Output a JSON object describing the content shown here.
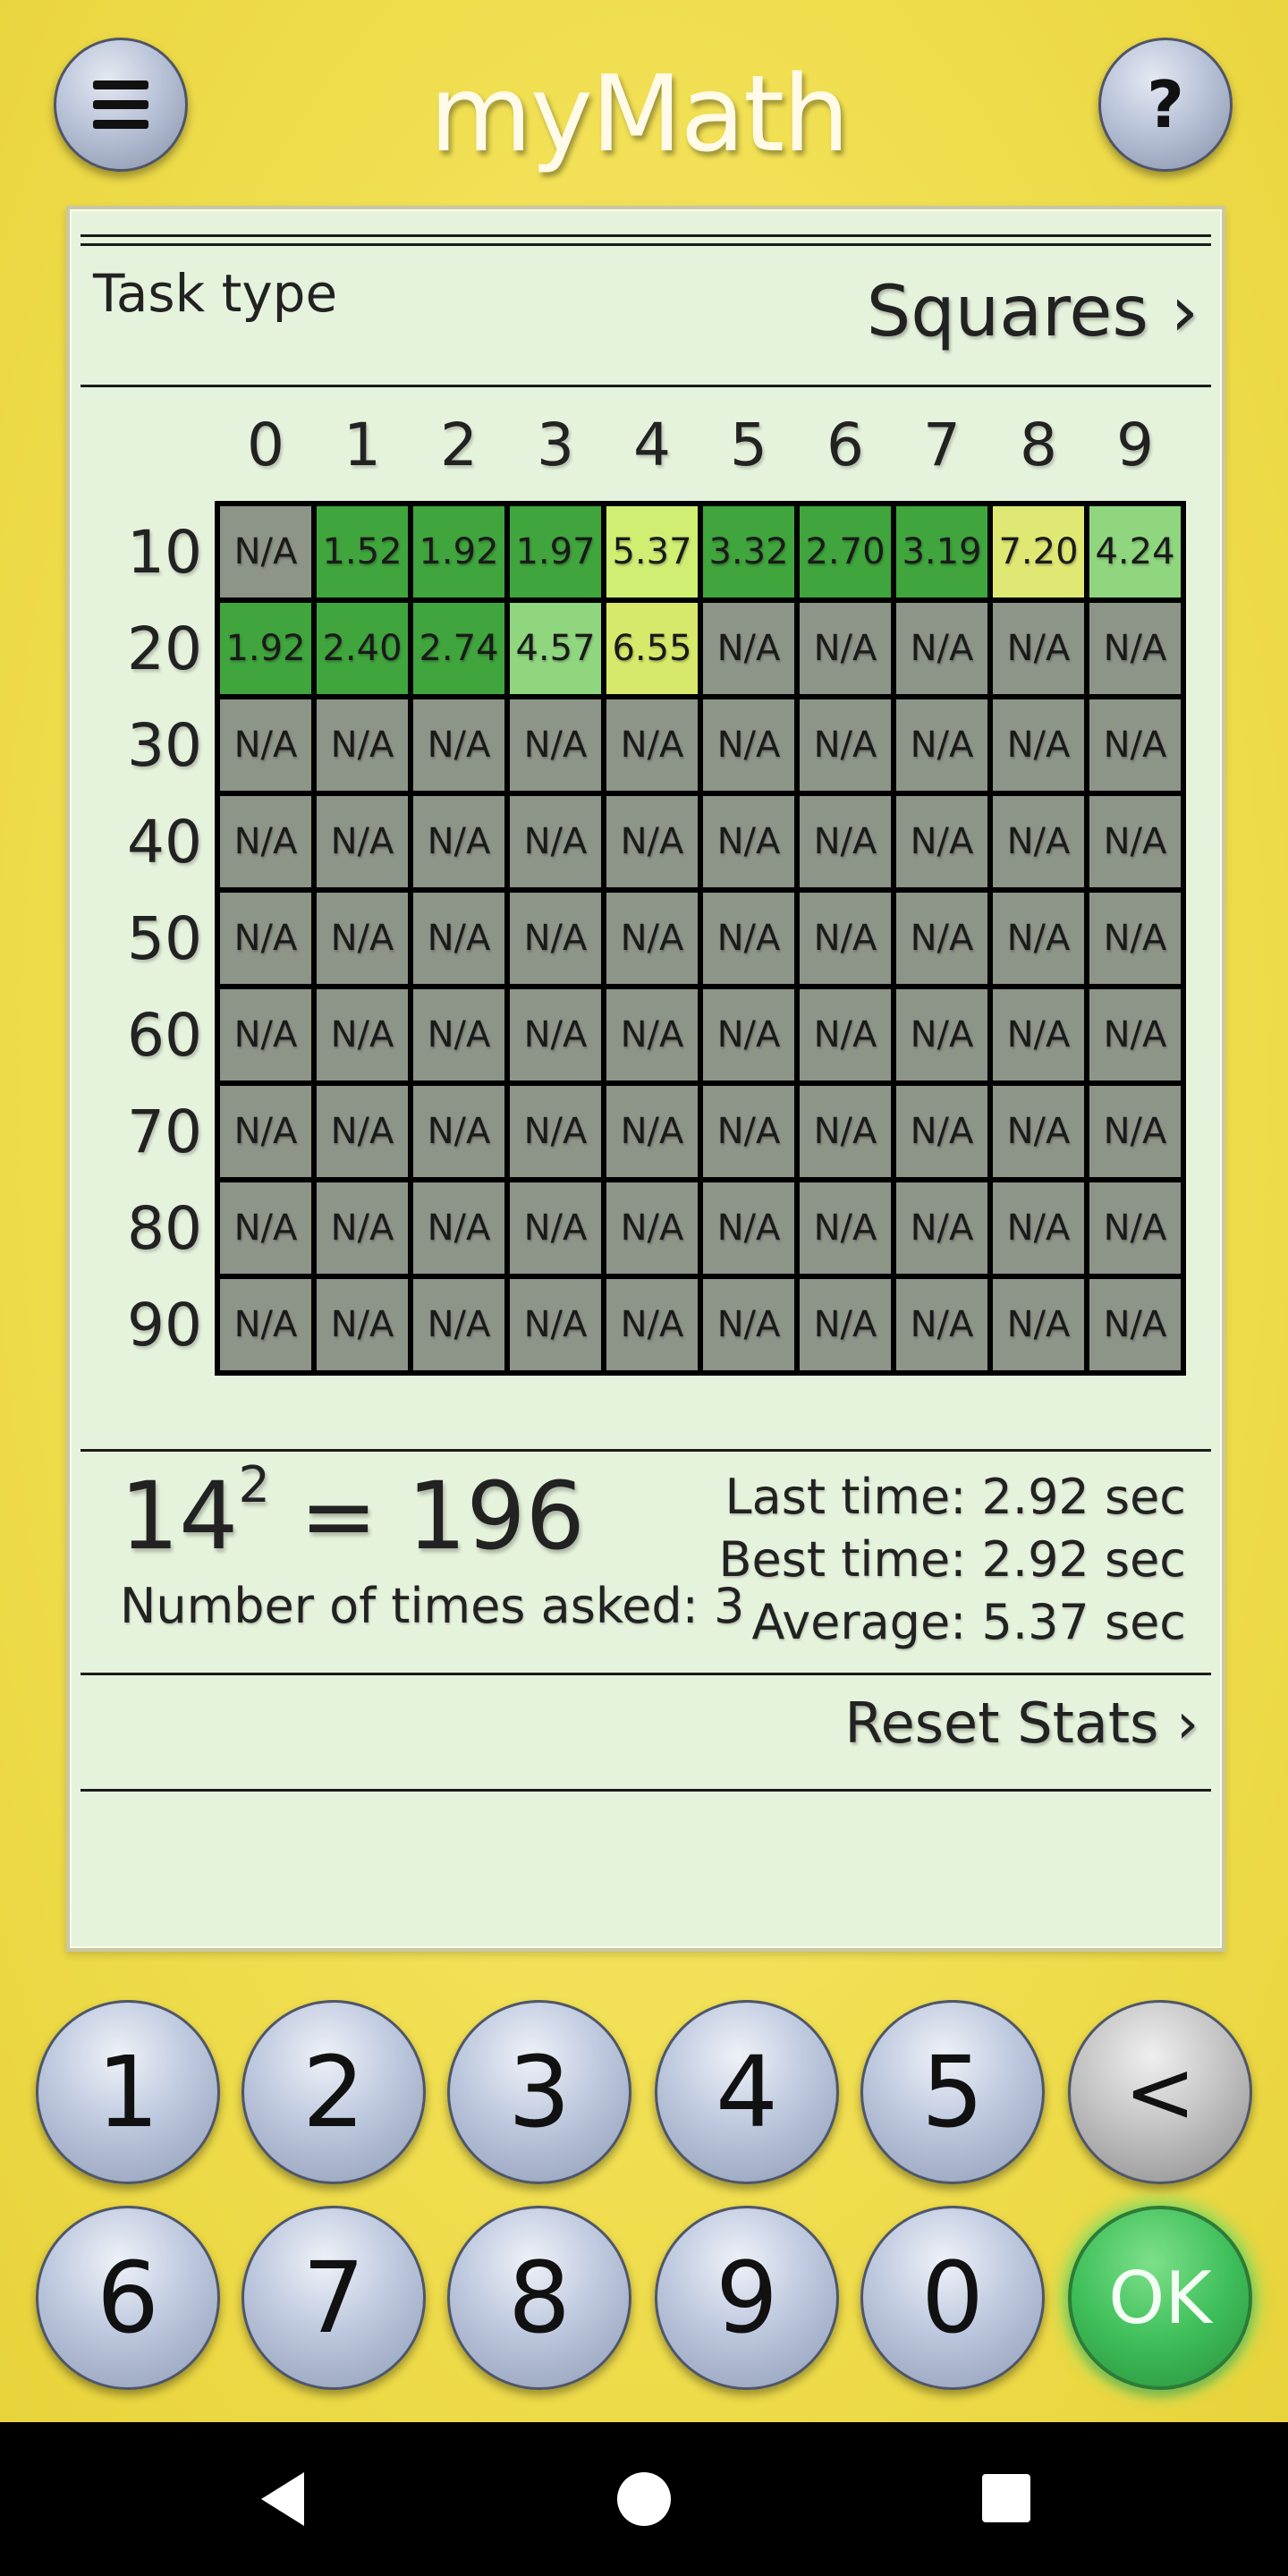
{
  "header": {
    "logo_text": "myMath",
    "menu_icon": "hamburger-menu-icon",
    "help_label": "?"
  },
  "task": {
    "label": "Task type",
    "value": "Squares ›"
  },
  "grid": {
    "columns": [
      "0",
      "1",
      "2",
      "3",
      "4",
      "5",
      "6",
      "7",
      "8",
      "9"
    ],
    "rows": [
      "10",
      "20",
      "30",
      "40",
      "50",
      "60",
      "70",
      "80",
      "90"
    ],
    "cells": [
      [
        "N/A",
        "1.52",
        "1.92",
        "1.97",
        "5.37",
        "3.32",
        "2.70",
        "3.19",
        "7.20",
        "4.24"
      ],
      [
        "1.92",
        "2.40",
        "2.74",
        "4.57",
        "6.55",
        "N/A",
        "N/A",
        "N/A",
        "N/A",
        "N/A"
      ],
      [
        "N/A",
        "N/A",
        "N/A",
        "N/A",
        "N/A",
        "N/A",
        "N/A",
        "N/A",
        "N/A",
        "N/A"
      ],
      [
        "N/A",
        "N/A",
        "N/A",
        "N/A",
        "N/A",
        "N/A",
        "N/A",
        "N/A",
        "N/A",
        "N/A"
      ],
      [
        "N/A",
        "N/A",
        "N/A",
        "N/A",
        "N/A",
        "N/A",
        "N/A",
        "N/A",
        "N/A",
        "N/A"
      ],
      [
        "N/A",
        "N/A",
        "N/A",
        "N/A",
        "N/A",
        "N/A",
        "N/A",
        "N/A",
        "N/A",
        "N/A"
      ],
      [
        "N/A",
        "N/A",
        "N/A",
        "N/A",
        "N/A",
        "N/A",
        "N/A",
        "N/A",
        "N/A",
        "N/A"
      ],
      [
        "N/A",
        "N/A",
        "N/A",
        "N/A",
        "N/A",
        "N/A",
        "N/A",
        "N/A",
        "N/A",
        "N/A"
      ],
      [
        "N/A",
        "N/A",
        "N/A",
        "N/A",
        "N/A",
        "N/A",
        "N/A",
        "N/A",
        "N/A",
        "N/A"
      ]
    ],
    "cell_colors": [
      [
        "#8d9488",
        "#3fa53c",
        "#3fa53c",
        "#3fa53c",
        "#cfee72",
        "#3fa53c",
        "#3fa53c",
        "#3fa53c",
        "#dfe873",
        "#8fd67e"
      ],
      [
        "#3fa53c",
        "#3fa53c",
        "#3fa53c",
        "#8fd67e",
        "#d8e86a",
        "#8d9488",
        "#8d9488",
        "#8d9488",
        "#8d9488",
        "#8d9488"
      ]
    ],
    "na_color": "#8d9488"
  },
  "stats": {
    "base": "14",
    "exponent": "2",
    "result": "196",
    "times_asked": "Number of times asked: 3",
    "last_time": "Last time: 2.92 sec",
    "best_time": "Best time: 2.92 sec",
    "average": "Average: 5.37 sec",
    "reset_label": "Reset Stats ›"
  },
  "keypad": {
    "row1": [
      "1",
      "2",
      "3",
      "4",
      "5",
      "<"
    ],
    "row2": [
      "6",
      "7",
      "8",
      "9",
      "0",
      "OK"
    ]
  },
  "navbar": {
    "back_icon": "nav-back-icon",
    "home_icon": "nav-home-icon",
    "recent_icon": "nav-recent-icon"
  }
}
